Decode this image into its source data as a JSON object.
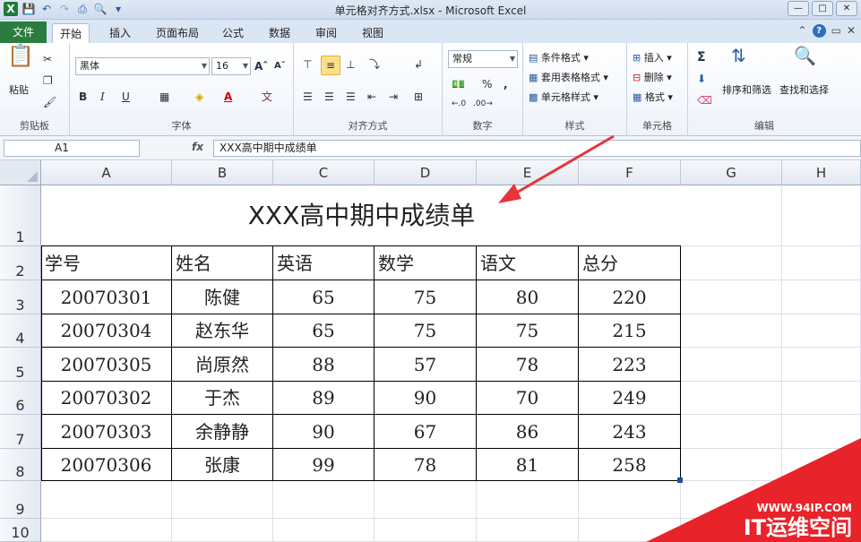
{
  "window": {
    "title": "单元格对齐方式.xlsx - Microsoft Excel",
    "logo": "X"
  },
  "ribbon_tabs": [
    "文件",
    "开始",
    "插入",
    "页面布局",
    "公式",
    "数据",
    "审阅",
    "视图"
  ],
  "clipboard": {
    "paste_label": "粘贴",
    "group_label": "剪贴板"
  },
  "font": {
    "name": "黑体",
    "size": "16",
    "bold": "B",
    "italic": "I",
    "underline": "U",
    "group_label": "字体"
  },
  "alignment": {
    "group_label": "对齐方式"
  },
  "number": {
    "format": "常规",
    "percent": "%",
    "comma": ",",
    "group_label": "数字"
  },
  "styles": {
    "conditional": "条件格式",
    "table_format": "套用表格格式",
    "cell_styles": "单元格样式",
    "group_label": "样式"
  },
  "cells_group": {
    "insert": "插入",
    "delete": "删除",
    "format": "格式",
    "group_label": "单元格"
  },
  "editing": {
    "sort_filter": "排序和筛选",
    "find_select": "查找和选择",
    "group_label": "编辑",
    "sigma": "Σ"
  },
  "formula_bar": {
    "name_box": "A1",
    "fx": "fx",
    "content": "XXX高中期中成绩单"
  },
  "columns": [
    "A",
    "B",
    "C",
    "D",
    "E",
    "F",
    "G",
    "H"
  ],
  "rows": [
    "1",
    "2",
    "3",
    "4",
    "5",
    "6",
    "7",
    "8",
    "9",
    "10"
  ],
  "sheet": {
    "title": "XXX高中期中成绩单",
    "headers": [
      "学号",
      "姓名",
      "英语",
      "数学",
      "语文",
      "总分"
    ],
    "data": [
      [
        "20070301",
        "陈健",
        "65",
        "75",
        "80",
        "220"
      ],
      [
        "20070304",
        "赵东华",
        "65",
        "75",
        "75",
        "215"
      ],
      [
        "20070305",
        "尚原然",
        "88",
        "57",
        "78",
        "223"
      ],
      [
        "20070302",
        "于杰",
        "89",
        "90",
        "70",
        "249"
      ],
      [
        "20070303",
        "余静静",
        "90",
        "67",
        "86",
        "243"
      ],
      [
        "20070306",
        "张康",
        "99",
        "78",
        "81",
        "258"
      ]
    ]
  },
  "watermark": {
    "url": "WWW.94IP.COM",
    "brand": "IT运维空间"
  },
  "colors": {
    "file_tab": "#2a7d3f",
    "arrow": "#e8343a",
    "watermark": "#e8232a"
  }
}
